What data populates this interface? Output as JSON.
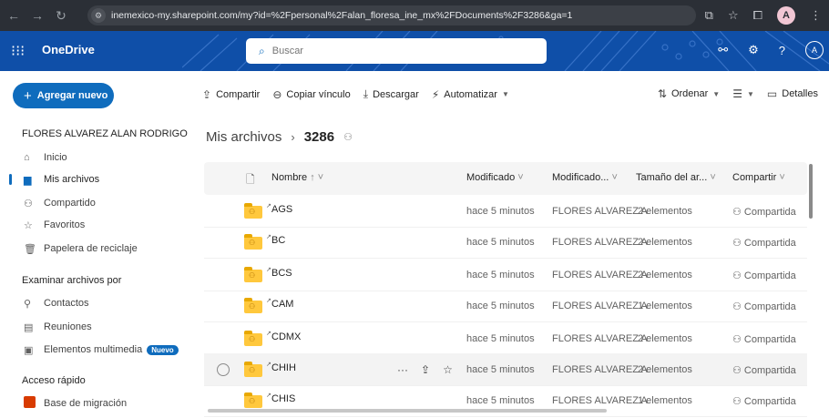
{
  "browser": {
    "url": "inemexico-my.sharepoint.com/my?id=%2Fpersonal%2Falan_floresa_ine_mx%2FDocuments%2F3286&ga=1",
    "profile_initial": "A"
  },
  "suite": {
    "app_name": "OneDrive",
    "search_placeholder": "Buscar",
    "avatar_initial": "A"
  },
  "leftnav": {
    "new_button": "Agregar nuevo",
    "user_name": "FLORES ALVAREZ ALAN RODRIGO",
    "items": [
      {
        "label": "Inicio",
        "icon": "home-icon"
      },
      {
        "label": "Mis archivos",
        "icon": "folder-icon"
      },
      {
        "label": "Compartido",
        "icon": "people-icon"
      },
      {
        "label": "Favoritos",
        "icon": "star-icon"
      },
      {
        "label": "Papelera de reciclaje",
        "icon": "trash-icon"
      }
    ],
    "browse_section": "Examinar archivos por",
    "browse_items": [
      {
        "label": "Contactos",
        "icon": "person-icon"
      },
      {
        "label": "Reuniones",
        "icon": "calendar-icon"
      },
      {
        "label": "Elementos multimedia",
        "icon": "image-icon",
        "badge": "Nuevo"
      }
    ],
    "quick_section": "Acceso rápido",
    "quick_items": [
      {
        "label": "Base de migración",
        "icon": "site-icon"
      }
    ]
  },
  "commands": {
    "share": "Compartir",
    "copy_link": "Copiar vínculo",
    "download": "Descargar",
    "automate": "Automatizar",
    "sort": "Ordenar",
    "details": "Detalles"
  },
  "breadcrumb": {
    "root": "Mis archivos",
    "current": "3286"
  },
  "table": {
    "columns": {
      "name": "Nombre",
      "modified": "Modificado",
      "modified_by": "Modificado...",
      "size": "Tamaño del ar...",
      "sharing": "Compartir"
    },
    "rows": [
      {
        "name": "AGS",
        "modified": "hace 5 minutos",
        "modified_by": "FLORES ALVAREZ A",
        "size": "2 elementos",
        "sharing": "Compartida"
      },
      {
        "name": "BC",
        "modified": "hace 5 minutos",
        "modified_by": "FLORES ALVAREZ A",
        "size": "2 elementos",
        "sharing": "Compartida"
      },
      {
        "name": "BCS",
        "modified": "hace 5 minutos",
        "modified_by": "FLORES ALVAREZ A",
        "size": "2 elementos",
        "sharing": "Compartida"
      },
      {
        "name": "CAM",
        "modified": "hace 5 minutos",
        "modified_by": "FLORES ALVAREZ A",
        "size": "1 elementos",
        "sharing": "Compartida"
      },
      {
        "name": "CDMX",
        "modified": "hace 5 minutos",
        "modified_by": "FLORES ALVAREZ A",
        "size": "2 elementos",
        "sharing": "Compartida"
      },
      {
        "name": "CHIH",
        "modified": "hace 5 minutos",
        "modified_by": "FLORES ALVAREZ A",
        "size": "2 elementos",
        "sharing": "Compartida"
      },
      {
        "name": "CHIS",
        "modified": "hace 5 minutos",
        "modified_by": "FLORES ALVAREZ A",
        "size": "1 elementos",
        "sharing": "Compartida"
      }
    ]
  },
  "colors": {
    "accent": "#0f6cbd",
    "suite_bar": "#0f4fa8",
    "folder": "#ffc83d"
  }
}
